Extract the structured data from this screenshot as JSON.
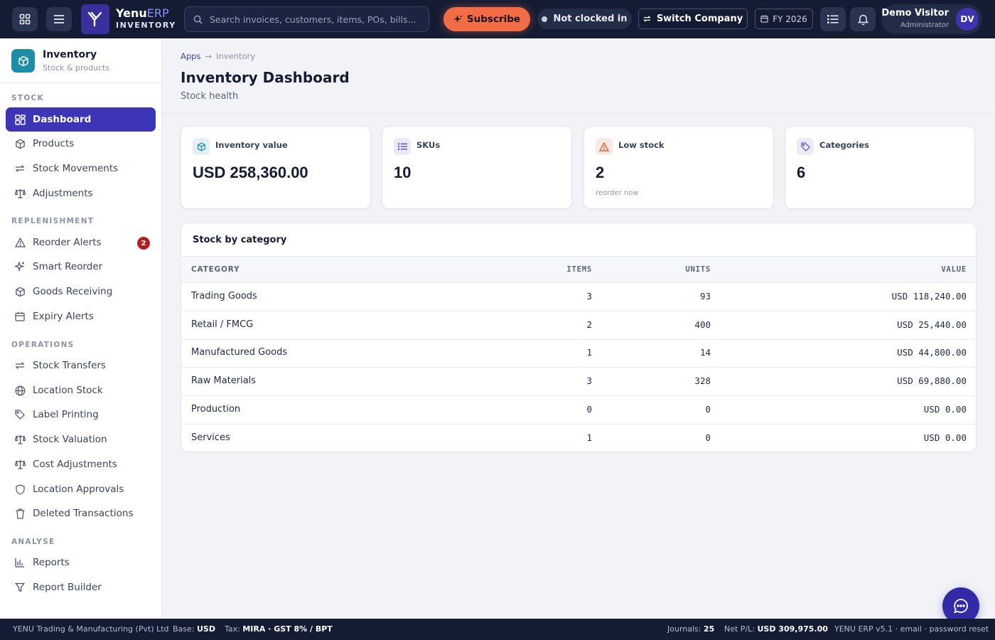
{
  "header": {
    "brand_prefix": "Yenu",
    "brand_accent": "ERP",
    "brand_sub": "INVENTORY",
    "search_placeholder": "Search invoices, customers, items, POs, bills...",
    "subscribe_label": "Subscribe",
    "clock_status": "Not clocked in",
    "switch_company_label": "Switch Company",
    "fiscal_year": "FY 2026",
    "user_name": "Demo Visitor",
    "user_role": "Administrator",
    "user_initials": "DV"
  },
  "sidebar": {
    "module_title": "Inventory",
    "module_subtitle": "Stock & products",
    "sections": {
      "stock": "STOCK",
      "replenishment": "REPLENISHMENT",
      "operations": "OPERATIONS",
      "analyse": "ANALYSE"
    },
    "items": {
      "dashboard": "Dashboard",
      "products": "Products",
      "stock_movements": "Stock Movements",
      "adjustments": "Adjustments",
      "reorder_alerts": "Reorder Alerts",
      "reorder_badge": "2",
      "smart_reorder": "Smart Reorder",
      "goods_receiving": "Goods Receiving",
      "expiry_alerts": "Expiry Alerts",
      "stock_transfers": "Stock Transfers",
      "location_stock": "Location Stock",
      "label_printing": "Label Printing",
      "stock_valuation": "Stock Valuation",
      "cost_adjustments": "Cost Adjustments",
      "location_approvals": "Location Approvals",
      "deleted_transactions": "Deleted Transactions",
      "reports": "Reports",
      "report_builder": "Report Builder"
    }
  },
  "main": {
    "breadcrumb_root": "Apps",
    "breadcrumb_sep": "→",
    "breadcrumb_current": "Inventory",
    "title": "Inventory Dashboard",
    "subtitle": "Stock health",
    "cards": {
      "value": {
        "label": "Inventory value",
        "value": "USD 258,360.00"
      },
      "skus": {
        "label": "SKUs",
        "value": "10"
      },
      "low": {
        "label": "Low stock",
        "value": "2",
        "note": "reorder now"
      },
      "categories": {
        "label": "Categories",
        "value": "6"
      }
    },
    "table": {
      "title": "Stock by category",
      "columns": {
        "category": "CATEGORY",
        "items": "ITEMS",
        "units": "UNITS",
        "value": "VALUE"
      },
      "rows": [
        {
          "category": "Trading Goods",
          "items": "3",
          "units": "93",
          "value": "USD 118,240.00"
        },
        {
          "category": "Retail / FMCG",
          "items": "2",
          "units": "400",
          "value": "USD 25,440.00"
        },
        {
          "category": "Manufactured Goods",
          "items": "1",
          "units": "14",
          "value": "USD 44,800.00"
        },
        {
          "category": "Raw Materials",
          "items": "3",
          "units": "328",
          "value": "USD 69,880.00"
        },
        {
          "category": "Production",
          "items": "0",
          "units": "0",
          "value": "USD 0.00"
        },
        {
          "category": "Services",
          "items": "1",
          "units": "0",
          "value": "USD 0.00"
        }
      ]
    }
  },
  "footer": {
    "company": "YENU Trading & Manufacturing (Pvt) Ltd",
    "base_label": "Base:",
    "base_value": "USD",
    "tax_label": "Tax:",
    "tax_value": "MIRA · GST 8% / BPT",
    "journals_label": "Journals:",
    "journals_value": "25",
    "netpl_label": "Net P/L:",
    "netpl_value": "USD 309,975.00",
    "version": "YENU ERP v5.1 · email · password reset"
  },
  "colors": {
    "topbar": "#141c33",
    "accent": "#3d34b8",
    "subscribe": "#f26d45",
    "badge": "#b3211e"
  }
}
